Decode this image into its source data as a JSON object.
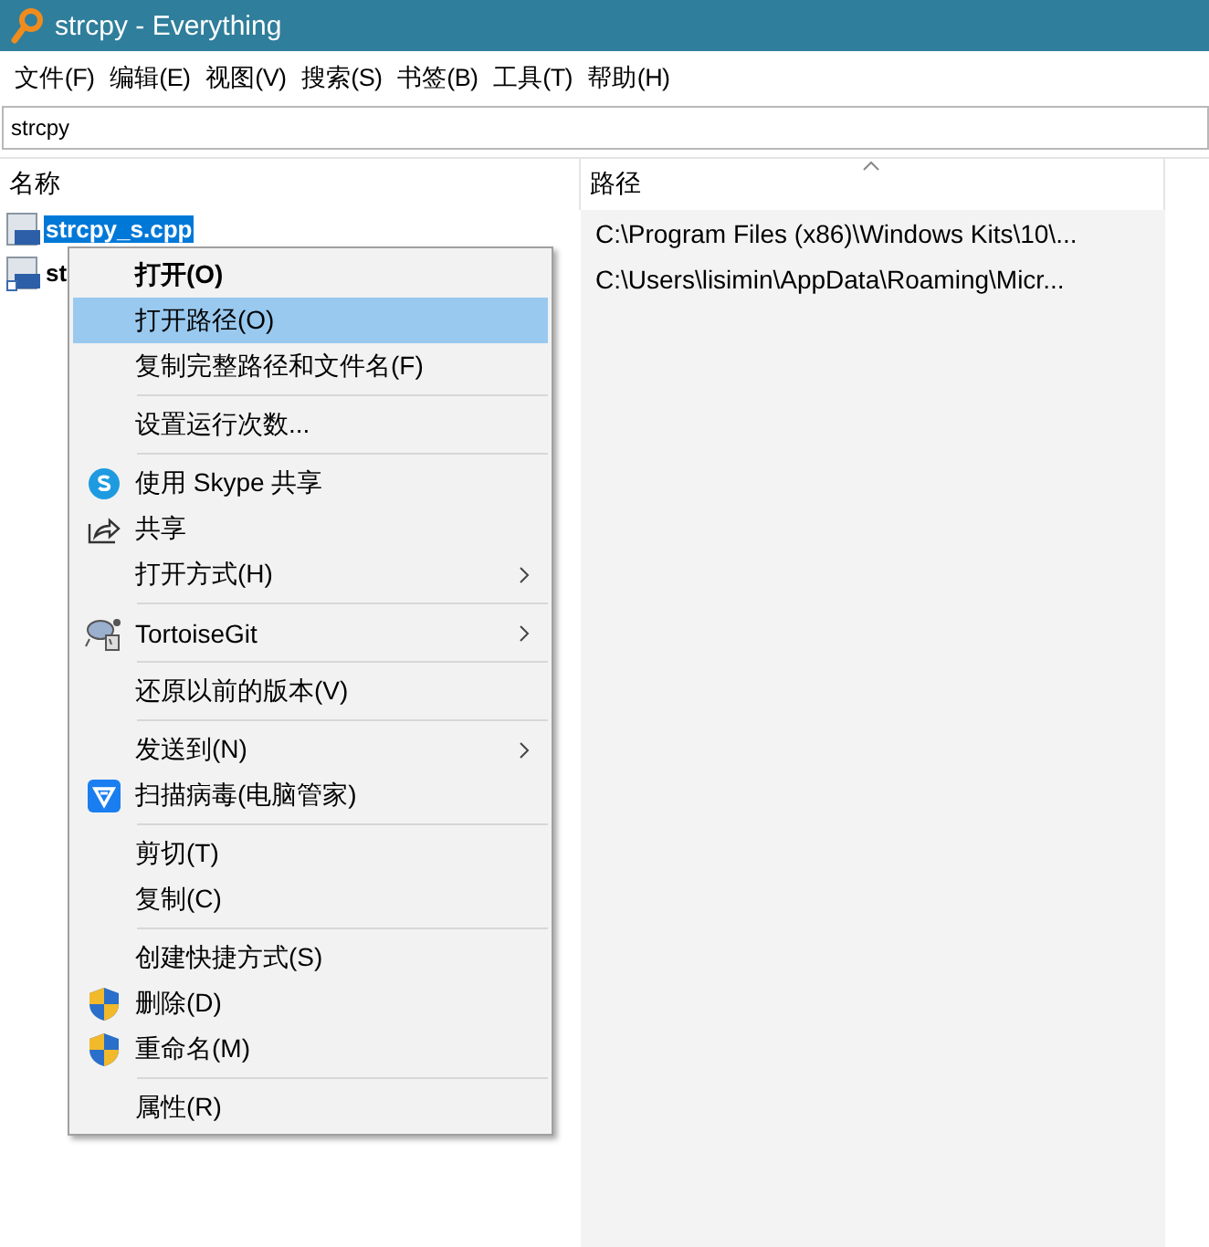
{
  "window": {
    "title": "strcpy - Everything"
  },
  "menu_bar": [
    "文件(F)",
    "编辑(E)",
    "视图(V)",
    "搜索(S)",
    "书签(B)",
    "工具(T)",
    "帮助(H)"
  ],
  "search": {
    "value": "strcpy"
  },
  "columns": [
    "名称",
    "路径"
  ],
  "rows": [
    {
      "name": "strcpy_s.cpp",
      "path": "C:\\Program Files (x86)\\Windows Kits\\10\\...",
      "selected": true
    },
    {
      "name": "st",
      "path": "C:\\Users\\lisimin\\AppData\\Roaming\\Micr...",
      "selected": false
    }
  ],
  "context_menu": [
    {
      "kind": "plain",
      "label": "打开(O)",
      "bold": true,
      "selected": false,
      "submenu": false
    },
    {
      "kind": "plain",
      "label": "打开路径(O)",
      "bold": false,
      "selected": true,
      "submenu": false
    },
    {
      "kind": "plain",
      "label": "复制完整路径和文件名(F)",
      "bold": false,
      "selected": false,
      "submenu": false
    },
    {
      "kind": "separator"
    },
    {
      "kind": "plain",
      "label": "设置运行次数...",
      "bold": false,
      "selected": false,
      "submenu": false
    },
    {
      "kind": "separator"
    },
    {
      "kind": "skype",
      "label": "使用 Skype 共享",
      "bold": false,
      "selected": false,
      "submenu": false
    },
    {
      "kind": "share",
      "label": "共享",
      "bold": false,
      "selected": false,
      "submenu": false
    },
    {
      "kind": "plain",
      "label": "打开方式(H)",
      "bold": false,
      "selected": false,
      "submenu": true
    },
    {
      "kind": "separator"
    },
    {
      "kind": "git",
      "label": "TortoiseGit",
      "bold": false,
      "selected": false,
      "submenu": true
    },
    {
      "kind": "separator"
    },
    {
      "kind": "plain",
      "label": "还原以前的版本(V)",
      "bold": false,
      "selected": false,
      "submenu": false
    },
    {
      "kind": "separator"
    },
    {
      "kind": "plain",
      "label": "发送到(N)",
      "bold": false,
      "selected": false,
      "submenu": true
    },
    {
      "kind": "antivirus",
      "label": "扫描病毒(电脑管家)",
      "bold": false,
      "selected": false,
      "submenu": false
    },
    {
      "kind": "separator"
    },
    {
      "kind": "plain",
      "label": "剪切(T)",
      "bold": false,
      "selected": false,
      "submenu": false
    },
    {
      "kind": "plain",
      "label": "复制(C)",
      "bold": false,
      "selected": false,
      "submenu": false
    },
    {
      "kind": "separator"
    },
    {
      "kind": "plain",
      "label": "创建快捷方式(S)",
      "bold": false,
      "selected": false,
      "submenu": false
    },
    {
      "kind": "shield",
      "label": "删除(D)",
      "bold": false,
      "selected": false,
      "submenu": false
    },
    {
      "kind": "shield",
      "label": "重命名(M)",
      "bold": false,
      "selected": false,
      "submenu": false
    },
    {
      "kind": "separator"
    },
    {
      "kind": "plain",
      "label": "属性(R)",
      "bold": false,
      "selected": false,
      "submenu": false
    }
  ]
}
